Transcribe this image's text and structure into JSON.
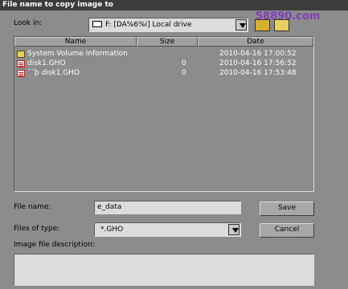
{
  "title": "File name to copy image to",
  "look_in": {
    "label": "Look in:",
    "value": "F: [DA%6%i] Local drive",
    "icon": "drive-icon"
  },
  "toolbar": {
    "up_folder_icon": "up-folder-icon",
    "new_folder_icon": "new-folder-icon"
  },
  "watermark": "58890.com",
  "columns": {
    "name": "Name",
    "size": "Size",
    "date": "Date"
  },
  "files": [
    {
      "icon": "folder-icon",
      "name": "System Volume Information",
      "size": "",
      "date": "2010-04-16 17:00:52"
    },
    {
      "icon": "ghost-file-icon",
      "name": "disk1.GHO",
      "size": "0",
      "date": "2010-04-16 17:56:52"
    },
    {
      "icon": "ghost-file-icon",
      "name": "˜´þ disk1.GHO",
      "size": "0",
      "date": "2010-04-16 17:53:48"
    }
  ],
  "file_name": {
    "label": "File name:",
    "value": "e_data"
  },
  "file_type": {
    "label": "Files of type:",
    "value": "*.GHO"
  },
  "description": {
    "label": "Image file description:",
    "value": ""
  },
  "buttons": {
    "save": "Save",
    "cancel": "Cancel"
  },
  "colors": {
    "title_bar": "#3c3c3c",
    "dialog_bg": "#8c8c8c",
    "field_bg": "#dcdcdc",
    "list_text": "#ffffff"
  }
}
